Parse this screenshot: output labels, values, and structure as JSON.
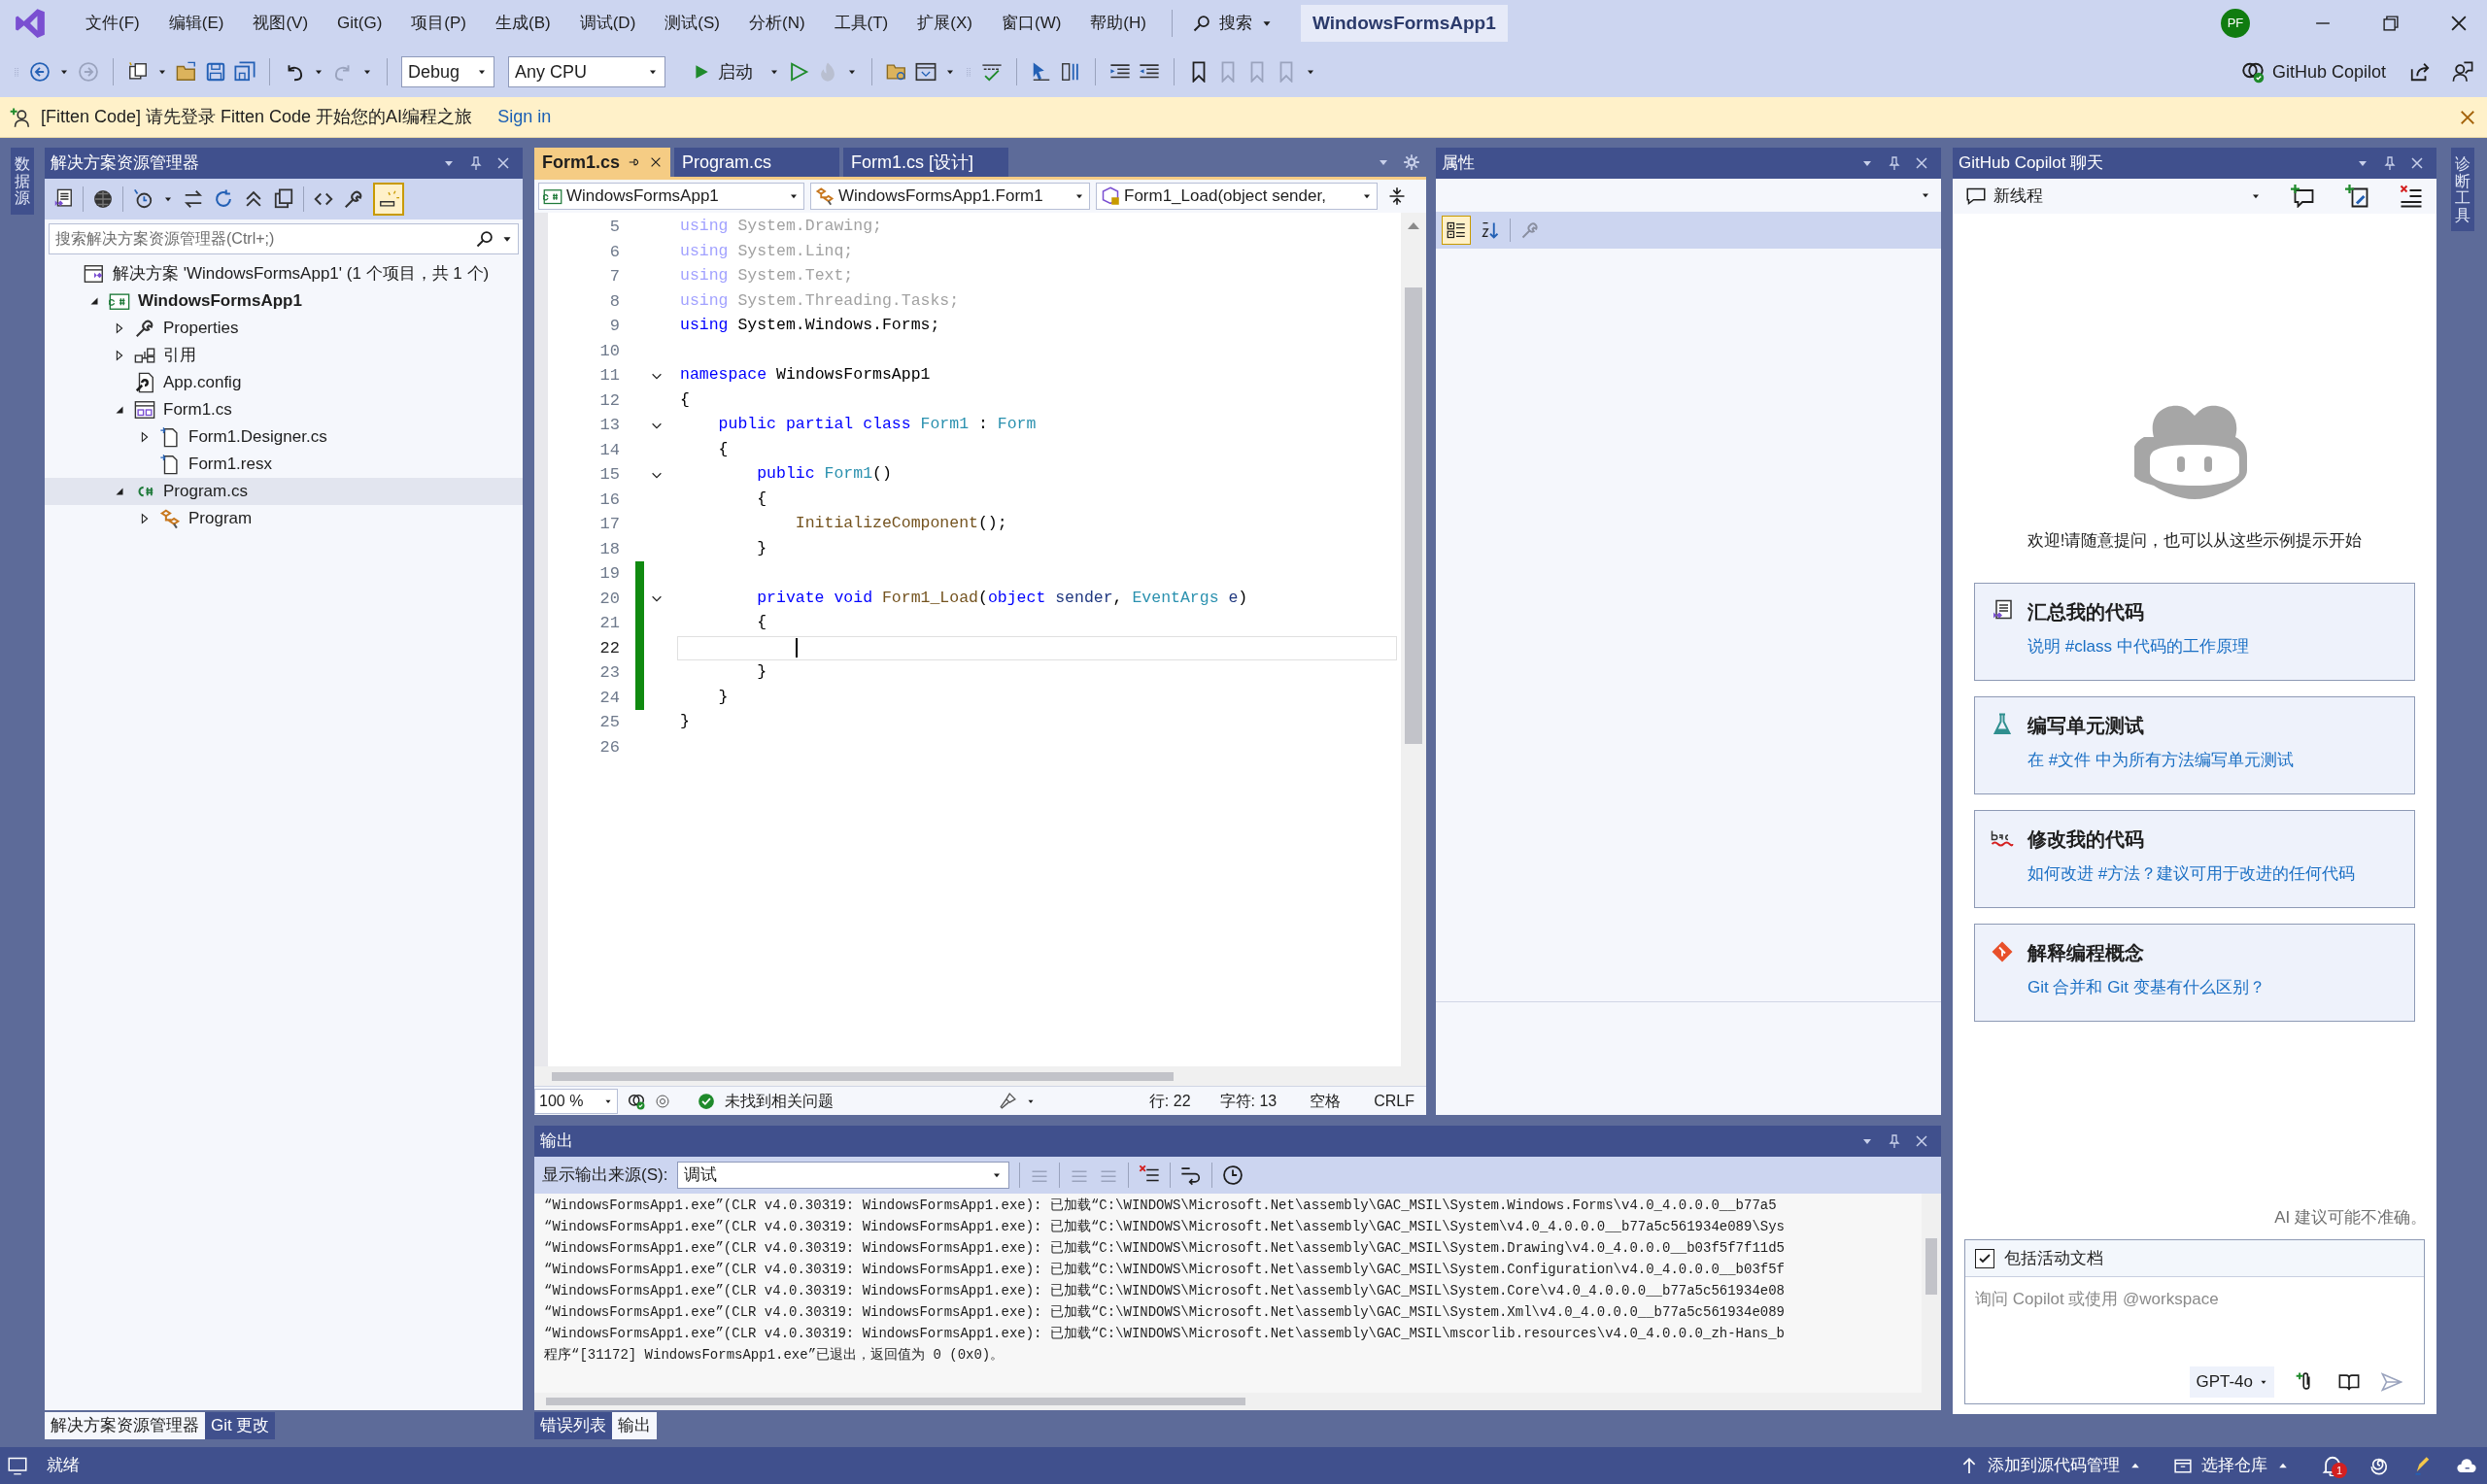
{
  "menu_bar": {
    "items": [
      "文件(F)",
      "编辑(E)",
      "视图(V)",
      "Git(G)",
      "项目(P)",
      "生成(B)",
      "调试(D)",
      "测试(S)",
      "分析(N)",
      "工具(T)",
      "扩展(X)",
      "窗口(W)",
      "帮助(H)"
    ],
    "search": "搜索",
    "title": "WindowsFormsApp1",
    "avatar": "PF"
  },
  "toolbar": {
    "configuration": "Debug",
    "platform": "Any CPU",
    "start": "启动",
    "copilot": "GitHub Copilot"
  },
  "info_bar": {
    "message": "[Fitten Code] 请先登录 Fitten Code 开始您的AI编程之旅",
    "link": "Sign in"
  },
  "left_strip": {
    "label": "数据源"
  },
  "solution_explorer": {
    "title": "解决方案资源管理器",
    "search": {
      "placeholder": "搜索解决方案资源管理器(Ctrl+;)"
    },
    "tree": [
      {
        "label": "解决方案 'WindowsFormsApp1' (1 个项目，共 1 个)",
        "kind": "solution",
        "selected": false,
        "children": [
          {
            "label": "WindowsFormsApp1",
            "kind": "project",
            "selected": false,
            "expanded": true,
            "children": [
              {
                "label": "Properties",
                "kind": "properties",
                "selected": false,
                "expanded": false
              },
              {
                "label": "引用",
                "kind": "references",
                "selected": false,
                "expanded": false
              },
              {
                "label": "App.config",
                "kind": "config",
                "selected": false
              },
              {
                "label": "Form1.cs",
                "kind": "form",
                "selected": false,
                "expanded": true,
                "children": [
                  {
                    "label": "Form1.Designer.cs",
                    "kind": "file",
                    "selected": false,
                    "expanded": false
                  },
                  {
                    "label": "Form1.resx",
                    "kind": "file",
                    "selected": false
                  }
                ]
              },
              {
                "label": "Program.cs",
                "kind": "cs",
                "selected": true,
                "expanded": true,
                "children": [
                  {
                    "label": "Program",
                    "kind": "class",
                    "selected": false,
                    "expanded": false
                  }
                ]
              }
            ]
          }
        ]
      }
    ]
  },
  "left_tabs": [
    {
      "label": "解决方案资源管理器",
      "selected": true
    },
    {
      "label": "Git 更改",
      "selected": false
    }
  ],
  "editor": {
    "tabs": [
      {
        "label": "Form1.cs",
        "selected": true
      },
      {
        "label": "Program.cs",
        "selected": false
      },
      {
        "label": "Form1.cs [设计]",
        "selected": false
      }
    ],
    "nav": [
      "WindowsFormsApp1",
      "WindowsFormsApp1.Form1",
      "Form1_Load(object sender,"
    ],
    "lines": [
      {
        "n": "5",
        "faded": true,
        "changed": false,
        "fold": false,
        "current": false,
        "tokens": [
          {
            "kind": "kw",
            "text": "using"
          },
          {
            "kind": "plain",
            "text": " System.Drawing;"
          }
        ]
      },
      {
        "n": "6",
        "faded": true,
        "changed": false,
        "fold": false,
        "current": false,
        "tokens": [
          {
            "kind": "kw",
            "text": "using"
          },
          {
            "kind": "plain",
            "text": " System.Linq;"
          }
        ]
      },
      {
        "n": "7",
        "faded": true,
        "changed": false,
        "fold": false,
        "current": false,
        "tokens": [
          {
            "kind": "kw",
            "text": "using"
          },
          {
            "kind": "plain",
            "text": " System.Text;"
          }
        ]
      },
      {
        "n": "8",
        "faded": true,
        "changed": false,
        "fold": false,
        "current": false,
        "tokens": [
          {
            "kind": "kw",
            "text": "using"
          },
          {
            "kind": "plain",
            "text": " System.Threading.Tasks;"
          }
        ]
      },
      {
        "n": "9",
        "faded": false,
        "changed": false,
        "fold": false,
        "current": false,
        "tokens": [
          {
            "kind": "kw",
            "text": "using"
          },
          {
            "kind": "plain",
            "text": " System.Windows.Forms;"
          }
        ]
      },
      {
        "n": "10",
        "changed": false,
        "fold": false,
        "current": false
      },
      {
        "n": "11",
        "faded": false,
        "changed": false,
        "fold": true,
        "current": false,
        "tokens": [
          {
            "kind": "kw",
            "text": "namespace"
          },
          {
            "kind": "plain",
            "text": " WindowsFormsApp1"
          }
        ]
      },
      {
        "n": "12",
        "faded": false,
        "changed": false,
        "fold": false,
        "current": false,
        "tokens": [
          {
            "kind": "plain",
            "text": "{"
          }
        ]
      },
      {
        "n": "13",
        "faded": false,
        "changed": false,
        "fold": true,
        "current": false,
        "tokens": [
          {
            "kind": "kw",
            "text": "    public partial class"
          },
          {
            "kind": "type",
            "text": " Form1"
          },
          {
            "kind": "plain",
            "text": " : "
          },
          {
            "kind": "type",
            "text": "Form"
          }
        ]
      },
      {
        "n": "14",
        "faded": false,
        "changed": false,
        "fold": false,
        "current": false,
        "tokens": [
          {
            "kind": "plain",
            "text": "    {"
          }
        ]
      },
      {
        "n": "15",
        "faded": false,
        "changed": false,
        "fold": true,
        "current": false,
        "tokens": [
          {
            "kind": "kw",
            "text": "        public"
          },
          {
            "kind": "type",
            "text": " Form1"
          },
          {
            "kind": "plain",
            "text": "()"
          }
        ]
      },
      {
        "n": "16",
        "faded": false,
        "changed": false,
        "fold": false,
        "current": false,
        "tokens": [
          {
            "kind": "plain",
            "text": "        {"
          }
        ]
      },
      {
        "n": "17",
        "faded": false,
        "changed": false,
        "fold": false,
        "current": false,
        "tokens": [
          {
            "kind": "method",
            "text": "            InitializeComponent"
          },
          {
            "kind": "plain",
            "text": "();"
          }
        ]
      },
      {
        "n": "18",
        "faded": false,
        "changed": false,
        "fold": false,
        "current": false,
        "tokens": [
          {
            "kind": "plain",
            "text": "        }"
          }
        ]
      },
      {
        "n": "19",
        "changed": true,
        "fold": false,
        "current": false
      },
      {
        "n": "20",
        "faded": false,
        "changed": true,
        "fold": true,
        "current": false,
        "tokens": [
          {
            "kind": "kw",
            "text": "        private void"
          },
          {
            "kind": "method",
            "text": " Form1_Load"
          },
          {
            "kind": "plain",
            "text": "("
          },
          {
            "kind": "kw",
            "text": "object"
          },
          {
            "kind": "param",
            "text": " sender"
          },
          {
            "kind": "plain",
            "text": ", "
          },
          {
            "kind": "type",
            "text": "EventArgs"
          },
          {
            "kind": "param",
            "text": " e"
          },
          {
            "kind": "plain",
            "text": ")"
          }
        ]
      },
      {
        "n": "21",
        "faded": false,
        "changed": true,
        "fold": false,
        "current": false,
        "tokens": [
          {
            "kind": "plain",
            "text": "        {"
          }
        ]
      },
      {
        "n": "22",
        "changed": true,
        "fold": false,
        "current": true
      },
      {
        "n": "23",
        "faded": false,
        "changed": true,
        "fold": false,
        "current": false,
        "tokens": [
          {
            "kind": "plain",
            "text": "        }"
          }
        ]
      },
      {
        "n": "24",
        "faded": false,
        "changed": true,
        "fold": false,
        "current": false,
        "tokens": [
          {
            "kind": "plain",
            "text": "    }"
          }
        ]
      },
      {
        "n": "25",
        "faded": false,
        "changed": false,
        "fold": false,
        "current": false,
        "tokens": [
          {
            "kind": "plain",
            "text": "}"
          }
        ]
      },
      {
        "n": "26",
        "changed": false,
        "fold": false,
        "current": false
      }
    ],
    "status": {
      "zoom": "100 %",
      "issues": "未找到相关问题",
      "line": "行: 22",
      "char": "字符: 13",
      "indent": "空格",
      "eol": "CRLF"
    }
  },
  "properties": {
    "title": "属性"
  },
  "output": {
    "title": "输出",
    "source_label": "显示输出来源(S):",
    "source": "调试",
    "lines": [
      "“WindowsFormsApp1.exe”(CLR v4.0.30319: WindowsFormsApp1.exe): 已加载“C:\\WINDOWS\\Microsoft.Net\\assembly\\GAC_MSIL\\System.Windows.Forms\\v4.0_4.0.0.0__b77a5",
      "“WindowsFormsApp1.exe”(CLR v4.0.30319: WindowsFormsApp1.exe): 已加载“C:\\WINDOWS\\Microsoft.Net\\assembly\\GAC_MSIL\\System\\v4.0_4.0.0.0__b77a5c561934e089\\Sys",
      "“WindowsFormsApp1.exe”(CLR v4.0.30319: WindowsFormsApp1.exe): 已加载“C:\\WINDOWS\\Microsoft.Net\\assembly\\GAC_MSIL\\System.Drawing\\v4.0_4.0.0.0__b03f5f7f11d5",
      "“WindowsFormsApp1.exe”(CLR v4.0.30319: WindowsFormsApp1.exe): 已加载“C:\\WINDOWS\\Microsoft.Net\\assembly\\GAC_MSIL\\System.Configuration\\v4.0_4.0.0.0__b03f5f",
      "“WindowsFormsApp1.exe”(CLR v4.0.30319: WindowsFormsApp1.exe): 已加载“C:\\WINDOWS\\Microsoft.Net\\assembly\\GAC_MSIL\\System.Core\\v4.0_4.0.0.0__b77a5c561934e08",
      "“WindowsFormsApp1.exe”(CLR v4.0.30319: WindowsFormsApp1.exe): 已加载“C:\\WINDOWS\\Microsoft.Net\\assembly\\GAC_MSIL\\System.Xml\\v4.0_4.0.0.0__b77a5c561934e089",
      "“WindowsFormsApp1.exe”(CLR v4.0.30319: WindowsFormsApp1.exe): 已加载“C:\\WINDOWS\\Microsoft.Net\\assembly\\GAC_MSIL\\mscorlib.resources\\v4.0_4.0.0.0_zh-Hans_b",
      "程序“[31172] WindowsFormsApp1.exe”已退出，返回值为 0 (0x0)。"
    ]
  },
  "bottom_tabs": [
    {
      "label": "错误列表",
      "selected": false
    },
    {
      "label": "输出",
      "selected": true
    }
  ],
  "copilot": {
    "title": "GitHub Copilot 聊天",
    "thread": "新线程",
    "welcome": "欢迎!请随意提问，也可以从这些示例提示开始",
    "prompts": [
      {
        "kind": "summarize",
        "title": "汇总我的代码",
        "subtitle": "说明 #class 中代码的工作原理"
      },
      {
        "kind": "test",
        "title": "编写单元测试",
        "subtitle": "在 #文件 中为所有方法编写单元测试"
      },
      {
        "kind": "fix",
        "title": "修改我的代码",
        "subtitle": "如何改进 #方法？建议可用于改进的任何代码"
      },
      {
        "kind": "git",
        "title": "解释编程概念",
        "subtitle": "Git 合并和 Git 变基有什么区别？"
      }
    ],
    "disclaimer": "AI 建议可能不准确。",
    "include_doc": {
      "label": "包括活动文档",
      "checked": true
    },
    "input": {
      "placeholder": "询问 Copilot 或使用 @workspace"
    },
    "model": "GPT-4o"
  },
  "right_strip": {
    "label": "诊断工具"
  },
  "status_bar": {
    "ready": "就绪",
    "source_control": "添加到源代码管理",
    "repo": "选择仓库",
    "notifications": "1"
  }
}
